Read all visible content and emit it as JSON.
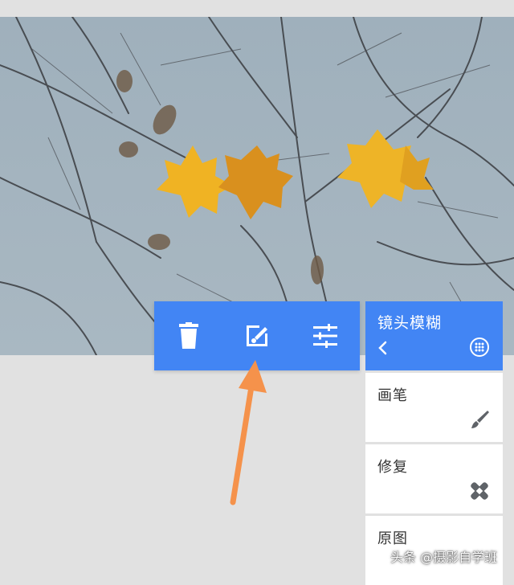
{
  "photo": {
    "subject": "maple leaves on bare branches",
    "sky_color": "#a2b2bd",
    "leaf_color": "#e9aa1e"
  },
  "toolbar": {
    "buttons": [
      {
        "name": "delete",
        "icon": "trash-icon"
      },
      {
        "name": "edit",
        "icon": "edit-brush-icon"
      },
      {
        "name": "adjust",
        "icon": "sliders-icon"
      }
    ],
    "accent": "#4285f4"
  },
  "annotation": {
    "arrow_color": "#f5924b",
    "points_to": "edit-button"
  },
  "panel": {
    "title": "镜头模糊",
    "back_icon": "chevron-left-icon",
    "more_icon": "dots-circle-icon",
    "items": [
      {
        "label": "画笔",
        "icon": "brush-icon"
      },
      {
        "label": "修复",
        "icon": "bandage-icon"
      },
      {
        "label": "原图",
        "icon": ""
      }
    ]
  },
  "watermark": {
    "text": "头条 @摄影自学班"
  }
}
